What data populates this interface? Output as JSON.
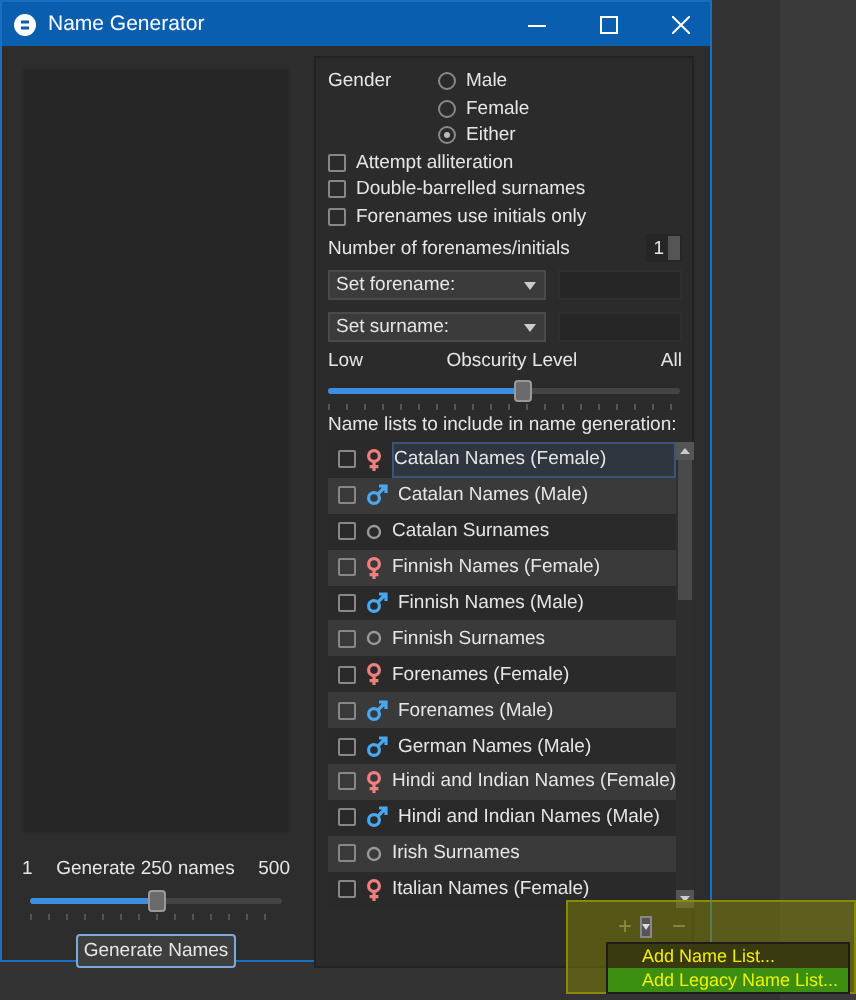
{
  "window": {
    "title": "Name Generator"
  },
  "left": {
    "min_label": "1",
    "count_label": "Generate 250 names",
    "max_label": "500",
    "count_slider": {
      "level": 0.5
    },
    "generate_button": "Generate Names"
  },
  "gender": {
    "label": "Gender",
    "options": [
      {
        "label": "Male",
        "selected": false
      },
      {
        "label": "Female",
        "selected": false
      },
      {
        "label": "Either",
        "selected": true
      }
    ]
  },
  "options": [
    {
      "label": "Attempt alliteration",
      "checked": false
    },
    {
      "label": "Double-barrelled surnames",
      "checked": false
    },
    {
      "label": "Forenames use initials only",
      "checked": false
    }
  ],
  "forename_count": {
    "label": "Number of forenames/initials",
    "value": "1"
  },
  "set_forename": {
    "label": "Set forename:"
  },
  "set_surname": {
    "label": "Set surname:"
  },
  "obscurity": {
    "low": "Low",
    "label": "Obscurity Level",
    "high": "All",
    "level": 0.55
  },
  "name_lists": {
    "label": "Name lists to include in name generation:",
    "items": [
      {
        "label": "Catalan Names (Female)",
        "kind": "female",
        "checked": false,
        "selected": true
      },
      {
        "label": "Catalan Names (Male)",
        "kind": "male",
        "checked": false,
        "selected": false
      },
      {
        "label": "Catalan Surnames",
        "kind": "surname",
        "checked": false,
        "selected": false
      },
      {
        "label": "Finnish Names (Female)",
        "kind": "female",
        "checked": false,
        "selected": false
      },
      {
        "label": "Finnish Names (Male)",
        "kind": "male",
        "checked": false,
        "selected": false
      },
      {
        "label": "Finnish Surnames",
        "kind": "surname",
        "checked": false,
        "selected": false
      },
      {
        "label": "Forenames (Female)",
        "kind": "female",
        "checked": false,
        "selected": false
      },
      {
        "label": "Forenames (Male)",
        "kind": "male",
        "checked": false,
        "selected": false
      },
      {
        "label": "German Names (Male)",
        "kind": "male",
        "checked": false,
        "selected": false
      },
      {
        "label": "Hindi and Indian Names (Female)",
        "kind": "female",
        "checked": false,
        "selected": false
      },
      {
        "label": "Hindi and Indian Names (Male)",
        "kind": "male",
        "checked": false,
        "selected": false
      },
      {
        "label": "Irish Surnames",
        "kind": "surname",
        "checked": false,
        "selected": false
      },
      {
        "label": "Italian Names (Female)",
        "kind": "female",
        "checked": false,
        "selected": false
      }
    ]
  },
  "list_toolbar": {
    "add": "+",
    "remove": "−",
    "menu": [
      {
        "label": "Add Name List...",
        "selected": false
      },
      {
        "label": "Add Legacy Name List...",
        "selected": true
      }
    ]
  }
}
